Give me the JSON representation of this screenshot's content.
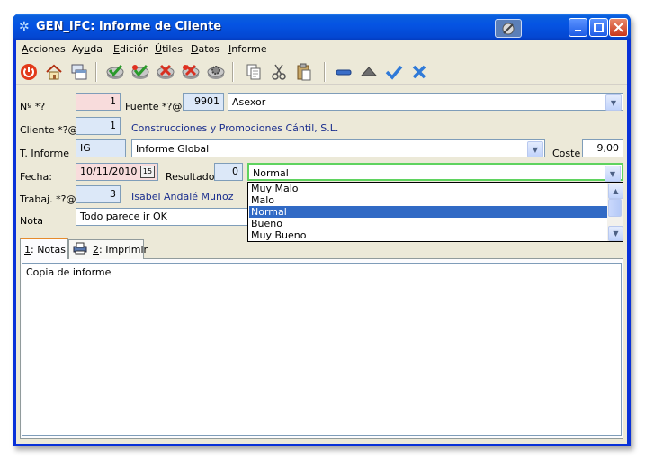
{
  "window": {
    "title": "GEN_IFC: Informe de Cliente"
  },
  "menu": {
    "acciones": {
      "pre": "",
      "u": "A",
      "post": "cciones"
    },
    "ayuda": {
      "pre": "Ay",
      "u": "u",
      "post": "da"
    },
    "edicion": {
      "pre": "",
      "u": "E",
      "post": "dición"
    },
    "utiles": {
      "pre": "",
      "u": "Ú",
      "post": "tiles"
    },
    "datos": {
      "pre": "",
      "u": "D",
      "post": "atos"
    },
    "informe": {
      "pre": "",
      "u": "I",
      "post": "nforme"
    }
  },
  "toolbar": {
    "icons": [
      "power-icon",
      "home-icon",
      "windows-icon",
      "check-icon",
      "check-add-icon",
      "delete-icon",
      "delete-red-icon",
      "gear-icon",
      "copy-icon",
      "cut-icon",
      "paste-icon",
      "minus-icon",
      "eject-icon",
      "accept-icon",
      "cancel-icon"
    ]
  },
  "form": {
    "numero_label": "Nº *?",
    "numero_value": "1",
    "fuente_label": "Fuente *?@:",
    "fuente_code": "9901",
    "fuente_name": "Asexor",
    "cliente_label": "Cliente *?@:",
    "cliente_code": "1",
    "cliente_name": "Construcciones y Promociones Cántil, S.L.",
    "tinforme_label": "T. Informe",
    "tinforme_code": "IG",
    "tinforme_name": "Informe Global",
    "coste_label": "Coste",
    "coste_value": "9,00",
    "fecha_label": "Fecha:",
    "fecha_value": "10/11/2010",
    "calendar_glyph": "15",
    "resultado_label": "Resultado",
    "resultado_code": "0",
    "resultado_value": "Normal",
    "trabaj_label": "Trabaj. *?@",
    "trabaj_code": "3",
    "trabaj_name": "Isabel Andalé Muñoz",
    "nota_label": "Nota",
    "nota_value": "Todo parece ir OK"
  },
  "dropdown": {
    "options": [
      "Muy Malo",
      "Malo",
      "Normal",
      "Bueno",
      "Muy Bueno"
    ],
    "selected": "Normal"
  },
  "tabs": {
    "notas": {
      "u": "1",
      "post": ": Notas"
    },
    "imprimir": {
      "u": "2",
      "post": ": Imprimir"
    }
  },
  "notes_text": "Copia de informe",
  "colors": {
    "titlebar": "#0554e3",
    "selection": "#316ac5",
    "link": "#1a2e8e"
  }
}
